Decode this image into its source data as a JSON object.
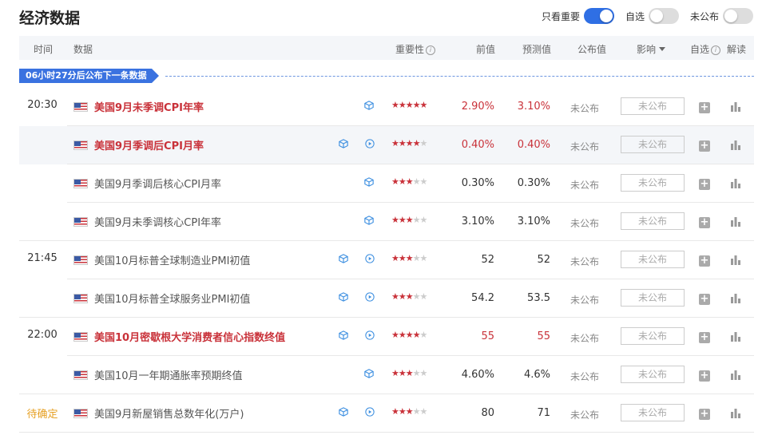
{
  "title": "经济数据",
  "toggles": [
    {
      "label": "只看重要",
      "on": true
    },
    {
      "label": "自选",
      "on": false
    },
    {
      "label": "未公布",
      "on": false
    }
  ],
  "header": {
    "time": "时间",
    "data": "数据",
    "importance": "重要性",
    "previous": "前值",
    "forecast": "预测值",
    "actual": "公布值",
    "impact": "影响",
    "watchlist": "自选",
    "interpret": "解读"
  },
  "banner": "06小时27分后公布下一条数据",
  "rows": [
    {
      "time": "20:30",
      "name": "美国9月未季调CPI年率",
      "stars": 5,
      "previous": "2.90%",
      "forecast": "3.10%",
      "actual": "未公布",
      "impact": "未公布",
      "bold": true,
      "red": true,
      "highlight": false,
      "play": false
    },
    {
      "time": "",
      "name": "美国9月季调后CPI月率",
      "stars": 4,
      "previous": "0.40%",
      "forecast": "0.40%",
      "actual": "未公布",
      "impact": "未公布",
      "bold": true,
      "red": true,
      "highlight": true,
      "play": true
    },
    {
      "time": "",
      "name": "美国9月季调后核心CPI月率",
      "stars": 3,
      "previous": "0.30%",
      "forecast": "0.30%",
      "actual": "未公布",
      "impact": "未公布",
      "bold": false,
      "red": false,
      "highlight": false,
      "play": false
    },
    {
      "time": "",
      "name": "美国9月未季调核心CPI年率",
      "stars": 3,
      "previous": "3.10%",
      "forecast": "3.10%",
      "actual": "未公布",
      "impact": "未公布",
      "bold": false,
      "red": false,
      "highlight": false,
      "play": false
    },
    {
      "time": "21:45",
      "name": "美国10月标普全球制造业PMI初值",
      "stars": 3,
      "previous": "52",
      "forecast": "52",
      "actual": "未公布",
      "impact": "未公布",
      "bold": false,
      "red": false,
      "highlight": false,
      "play": true
    },
    {
      "time": "",
      "name": "美国10月标普全球服务业PMI初值",
      "stars": 3,
      "previous": "54.2",
      "forecast": "53.5",
      "actual": "未公布",
      "impact": "未公布",
      "bold": false,
      "red": false,
      "highlight": false,
      "play": true
    },
    {
      "time": "22:00",
      "name": "美国10月密歇根大学消费者信心指数终值",
      "stars": 4,
      "previous": "55",
      "forecast": "55",
      "actual": "未公布",
      "impact": "未公布",
      "bold": true,
      "red": true,
      "highlight": false,
      "play": true
    },
    {
      "time": "",
      "name": "美国10月一年期通胀率预期终值",
      "stars": 3,
      "previous": "4.60%",
      "forecast": "4.6%",
      "actual": "未公布",
      "impact": "未公布",
      "bold": false,
      "red": false,
      "highlight": false,
      "play": false
    },
    {
      "time": "待确定",
      "name": "美国9月新屋销售总数年化(万户)",
      "stars": 3,
      "previous": "80",
      "forecast": "71",
      "actual": "未公布",
      "impact": "未公布",
      "bold": false,
      "red": false,
      "highlight": false,
      "play": true,
      "pending": true
    }
  ],
  "colors": {
    "accent": "#2f6fe4",
    "important": "#c9323a",
    "pending": "#e6a023"
  }
}
